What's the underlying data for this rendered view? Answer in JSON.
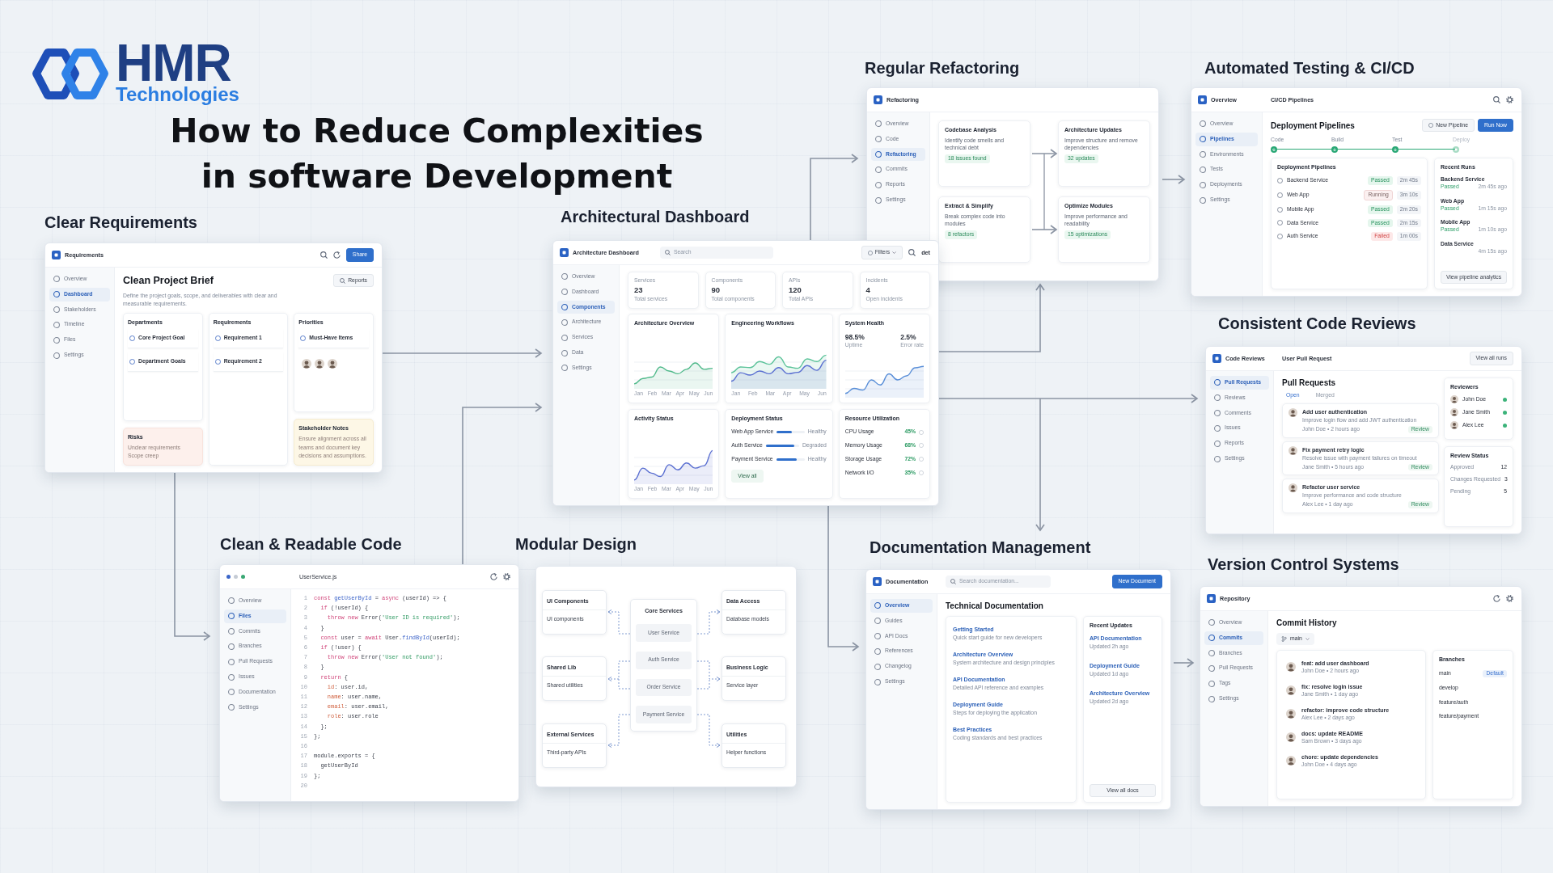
{
  "logo": {
    "brand": "HMR",
    "tagline": "Technologies"
  },
  "title": [
    "How to Reduce Complexities",
    "in software Development"
  ],
  "sections": [
    {
      "kind": "requirements",
      "heading": "Clear Requirements",
      "app": "Requirements",
      "share": "Share",
      "nav": [
        {
          "label": "Overview",
          "selected": false
        },
        {
          "label": "Dashboard",
          "selected": true
        },
        {
          "label": "Stakeholders",
          "selected": false
        },
        {
          "label": "Timeline",
          "selected": false
        },
        {
          "label": "Files",
          "selected": false
        },
        {
          "label": "Settings",
          "selected": false
        }
      ],
      "title": "Clean Project Brief",
      "reports": "Reports",
      "description": "Define the project goals, scope, and deliverables with clear and measurable requirements.",
      "columns": [
        {
          "title": "Departments",
          "items": [
            "Core Project Goal",
            "Department Goals"
          ],
          "note": {
            "kind": "risk",
            "title": "Risks",
            "items": [
              "Unclear requirements",
              "Scope creep"
            ]
          }
        },
        {
          "title": "Requirements",
          "items": [
            "Requirement 1",
            "Requirement 2"
          ]
        },
        {
          "title": "Priorities",
          "items": [
            "Must-Have Items"
          ],
          "avatars": [
            {
              "kind": "photo"
            },
            {
              "kind": "photo"
            },
            {
              "kind": "photo"
            }
          ],
          "note": {
            "kind": "info",
            "title": "Stakeholder Notes",
            "text": "Ensure alignment across all teams and document key decisions and assumptions."
          }
        }
      ]
    },
    {
      "kind": "dashboard",
      "heading": "Architectural Dashboard",
      "app": "Architecture Dashboard",
      "search": {
        "placeholder": "Search"
      },
      "filters": "Filters",
      "user": "det",
      "nav": [
        {
          "label": "Overview",
          "selected": false
        },
        {
          "label": "Dashboard",
          "selected": false
        },
        {
          "label": "Components",
          "selected": true
        },
        {
          "label": "Architecture",
          "selected": false
        },
        {
          "label": "Services",
          "selected": false
        },
        {
          "label": "Data",
          "selected": false
        },
        {
          "label": "Settings",
          "selected": false
        }
      ],
      "stats": [
        {
          "label": "Services",
          "value": "23",
          "caption": "Total services"
        },
        {
          "label": "Components",
          "value": "90",
          "caption": "Total components"
        },
        {
          "label": "APIs",
          "value": "120",
          "caption": "Total APIs"
        },
        {
          "label": "Incidents",
          "value": "4",
          "caption": "Open incidents"
        }
      ],
      "cards": [
        {
          "kind": "line",
          "title": "Architecture Overview",
          "months": [
            "Jan",
            "Feb",
            "Mar",
            "Apr",
            "May",
            "Jun"
          ]
        },
        {
          "kind": "dual",
          "title": "Engineering Workflows",
          "months": [
            "Jan",
            "Feb",
            "Mar",
            "Apr",
            "May",
            "Jun"
          ]
        },
        {
          "kind": "health",
          "title": "System Health",
          "metrics": [
            {
              "value": "98.5%",
              "label": "Uptime"
            },
            {
              "value": "2.5%",
              "label": "Error rate"
            }
          ]
        },
        {
          "kind": "line",
          "title": "Activity Status",
          "months": [
            "Jan",
            "Feb",
            "Mar",
            "Apr",
            "May",
            "Jun"
          ]
        },
        {
          "kind": "deploy",
          "title": "Deployment Status",
          "rows": [
            {
              "name": "Web App Service",
              "level": 0.55,
              "status": "Healthy"
            },
            {
              "name": "Auth Service",
              "level": 0.85,
              "status": "Degraded"
            },
            {
              "name": "Payment Service",
              "level": 0.72,
              "status": "Healthy"
            }
          ],
          "button": "View all"
        },
        {
          "kind": "resources",
          "title": "Resource Utilization",
          "rows": [
            {
              "name": "CPU Usage",
              "value": "45%"
            },
            {
              "name": "Memory Usage",
              "value": "68%"
            },
            {
              "name": "Storage Usage",
              "value": "72%"
            },
            {
              "name": "Network I/O",
              "value": "35%"
            }
          ]
        }
      ]
    },
    {
      "kind": "refactoring",
      "heading": "Regular Refactoring",
      "app": "Refactoring",
      "nav": [
        {
          "label": "Overview",
          "selected": false
        },
        {
          "label": "Code",
          "selected": false
        },
        {
          "label": "Refactoring",
          "selected": true
        },
        {
          "label": "Commits",
          "selected": false
        },
        {
          "label": "Reports",
          "selected": false
        },
        {
          "label": "Settings",
          "selected": false
        }
      ],
      "steps": [
        {
          "title": "Codebase Analysis",
          "text": "Identify code smells and technical debt",
          "badge": "18 issues found"
        },
        {
          "title": "Architecture Updates",
          "text": "Improve structure and remove dependencies",
          "badge": "32 updates"
        },
        {
          "title": "Extract & Simplify",
          "text": "Break complex code into modules",
          "badge": "8 refactors"
        },
        {
          "title": "Optimize Modules",
          "text": "Improve performance and readability",
          "badge": "15 optimizations"
        }
      ]
    },
    {
      "kind": "pipelines",
      "heading": "Automated Testing & CI/CD",
      "app": "Overview",
      "page": "CI/CD Pipelines",
      "nav": [
        {
          "label": "Overview",
          "selected": false
        },
        {
          "label": "Pipelines",
          "selected": true
        },
        {
          "label": "Environments",
          "selected": false
        },
        {
          "label": "Tests",
          "selected": false
        },
        {
          "label": "Deployments",
          "selected": false
        },
        {
          "label": "Settings",
          "selected": false
        }
      ],
      "title": "Deployment Pipelines",
      "buttons": [
        {
          "label": "New Pipeline",
          "kind": "outline"
        },
        {
          "label": "Run Now",
          "kind": "primary"
        }
      ],
      "stages": [
        {
          "label": "Code",
          "done": true
        },
        {
          "label": "Build",
          "done": true
        },
        {
          "label": "Test",
          "done": true
        },
        {
          "label": "Deploy",
          "done": false
        }
      ],
      "list": {
        "title": "Deployment Pipelines",
        "rows": [
          {
            "name": "Backend Service",
            "status": "Passed",
            "kind": "passed",
            "time": "2m 45s"
          },
          {
            "name": "Web App",
            "status": "Running",
            "kind": "running",
            "time": "3m 10s"
          },
          {
            "name": "Mobile App",
            "status": "Passed",
            "kind": "passed",
            "time": "2m 20s"
          },
          {
            "name": "Data Service",
            "status": "Passed",
            "kind": "passed",
            "time": "2m 15s"
          },
          {
            "name": "Auth Service",
            "status": "Failed",
            "kind": "failed",
            "time": "1m 00s"
          }
        ]
      },
      "recent": {
        "title": "Recent Runs",
        "runs": [
          {
            "name": "Backend Service",
            "status": "Passed",
            "time": "2m 45s ago"
          },
          {
            "name": "Web App",
            "status": "Passed",
            "time": "1m 15s ago"
          },
          {
            "name": "Mobile App",
            "status": "Passed",
            "time": "1m 10s ago"
          },
          {
            "name": "Data Service",
            "time": "4m 15s ago"
          }
        ],
        "button": "View pipeline analytics"
      }
    },
    {
      "kind": "reviews",
      "heading": "Consistent Code Reviews",
      "app": "Code Reviews",
      "page": "User Pull Request",
      "action": "View all runs",
      "nav": [
        {
          "label": "Pull Requests",
          "selected": true
        },
        {
          "label": "Reviews",
          "selected": false
        },
        {
          "label": "Comments",
          "selected": false
        },
        {
          "label": "Issues",
          "selected": false
        },
        {
          "label": "Reports",
          "selected": false
        },
        {
          "label": "Settings",
          "selected": false
        }
      ],
      "title": "Pull Requests",
      "tabs": [
        {
          "label": "Open",
          "selected": true
        },
        {
          "label": "Merged",
          "selected": false
        }
      ],
      "prs": [
        {
          "title": "Add user authentication",
          "text": "Improve login flow and add JWT authentication",
          "meta": "John Doe • 2 hours ago",
          "badge": "Review"
        },
        {
          "title": "Fix payment retry logic",
          "text": "Resolve issue with payment failures on timeout",
          "meta": "Jane Smith • 5 hours ago",
          "badge": "Review"
        },
        {
          "title": "Refactor user service",
          "text": "Improve performance and code structure",
          "meta": "Alex Lee • 1 day ago",
          "badge": "Review"
        }
      ],
      "reviewers": {
        "title": "Reviewers",
        "people": [
          {
            "name": "John Doe",
            "online": true
          },
          {
            "name": "Jane Smith",
            "online": true
          },
          {
            "name": "Alex Lee",
            "online": true
          }
        ]
      },
      "status": {
        "title": "Review Status",
        "rows": [
          {
            "label": "Approved",
            "value": "12"
          },
          {
            "label": "Changes Requested",
            "value": "3"
          },
          {
            "label": "Pending",
            "value": "5"
          }
        ]
      }
    },
    {
      "kind": "code",
      "heading": "Clean & Readable Code",
      "file": "UserService.js",
      "dots": [
        {
          "color": "#3b66c9"
        },
        {
          "color": "#c5cbd4"
        },
        {
          "color": "#3aa874"
        }
      ],
      "nav": [
        {
          "label": "Overview",
          "selected": false
        },
        {
          "label": "Files",
          "selected": true
        },
        {
          "label": "Commits",
          "selected": false
        },
        {
          "label": "Branches",
          "selected": false
        },
        {
          "label": "Pull Requests",
          "selected": false
        },
        {
          "label": "Issues",
          "selected": false
        },
        {
          "label": "Documentation",
          "selected": false
        },
        {
          "label": "Settings",
          "selected": false
        }
      ],
      "lines": [
        {
          "number": "1",
          "tokens": [
            {
              "kind": "kw",
              "text": "const "
            },
            {
              "kind": "fn",
              "text": "getUserById"
            },
            {
              "kind": "txt",
              "text": " = "
            },
            {
              "kind": "kw",
              "text": "async"
            },
            {
              "kind": "txt",
              "text": " (userId) => {"
            }
          ]
        },
        {
          "number": "2",
          "tokens": [
            {
              "kind": "kw",
              "text": "  if"
            },
            {
              "kind": "txt",
              "text": " (!userId) {"
            }
          ]
        },
        {
          "number": "3",
          "tokens": [
            {
              "kind": "kw",
              "text": "    throw new"
            },
            {
              "kind": "txt",
              "text": " Error("
            },
            {
              "kind": "str",
              "text": "'User ID is required'"
            },
            {
              "kind": "txt",
              "text": ");"
            }
          ]
        },
        {
          "number": "4",
          "tokens": [
            {
              "kind": "txt",
              "text": "  }"
            }
          ]
        },
        {
          "number": "5",
          "tokens": [
            {
              "kind": "kw",
              "text": "  const"
            },
            {
              "kind": "txt",
              "text": " user = "
            },
            {
              "kind": "kw",
              "text": "await"
            },
            {
              "kind": "txt",
              "text": " User."
            },
            {
              "kind": "fn",
              "text": "findById"
            },
            {
              "kind": "txt",
              "text": "(userId);"
            }
          ]
        },
        {
          "number": "6",
          "tokens": [
            {
              "kind": "kw",
              "text": "  if"
            },
            {
              "kind": "txt",
              "text": " (!user) {"
            }
          ]
        },
        {
          "number": "7",
          "tokens": [
            {
              "kind": "kw",
              "text": "    throw new"
            },
            {
              "kind": "txt",
              "text": " Error("
            },
            {
              "kind": "str",
              "text": "'User not found'"
            },
            {
              "kind": "txt",
              "text": ");"
            }
          ]
        },
        {
          "number": "8",
          "tokens": [
            {
              "kind": "txt",
              "text": "  }"
            }
          ]
        },
        {
          "number": "9",
          "tokens": [
            {
              "kind": "kw",
              "text": "  return"
            },
            {
              "kind": "txt",
              "text": " {"
            }
          ]
        },
        {
          "number": "10",
          "tokens": [
            {
              "kind": "prop",
              "text": "    id"
            },
            {
              "kind": "txt",
              "text": ": user.id,"
            }
          ]
        },
        {
          "number": "11",
          "tokens": [
            {
              "kind": "prop",
              "text": "    name"
            },
            {
              "kind": "txt",
              "text": ": user.name,"
            }
          ]
        },
        {
          "number": "12",
          "tokens": [
            {
              "kind": "prop",
              "text": "    email"
            },
            {
              "kind": "txt",
              "text": ": user.email,"
            }
          ]
        },
        {
          "number": "13",
          "tokens": [
            {
              "kind": "prop",
              "text": "    role"
            },
            {
              "kind": "txt",
              "text": ": user.role"
            }
          ]
        },
        {
          "number": "14",
          "tokens": [
            {
              "kind": "txt",
              "text": "  };"
            }
          ]
        },
        {
          "number": "15",
          "tokens": [
            {
              "kind": "txt",
              "text": "};"
            }
          ]
        },
        {
          "number": "16"
        },
        {
          "number": "17",
          "tokens": [
            {
              "kind": "txt",
              "text": "module.exports = {"
            }
          ]
        },
        {
          "number": "18",
          "tokens": [
            {
              "kind": "txt",
              "text": "  getUserById"
            }
          ]
        },
        {
          "number": "19",
          "tokens": [
            {
              "kind": "txt",
              "text": "};"
            }
          ]
        },
        {
          "number": "20"
        }
      ]
    },
    {
      "kind": "modular",
      "heading": "Modular Design",
      "left": [
        {
          "title": "UI Components",
          "text": "UI components"
        },
        {
          "title": "Shared Lib",
          "text": "Shared utilities"
        },
        {
          "title": "External Services",
          "text": "Third-party APIs"
        }
      ],
      "core": {
        "title": "Core Services",
        "items": [
          "User Service",
          "Auth Service",
          "Order Service",
          "Payment Service"
        ]
      },
      "right": [
        {
          "title": "Data Access",
          "text": "Database models"
        },
        {
          "title": "Business Logic",
          "text": "Service layer"
        },
        {
          "title": "Utilities",
          "text": "Helper functions"
        }
      ]
    },
    {
      "kind": "docs",
      "heading": "Documentation Management",
      "app": "Documentation",
      "search": {
        "placeholder": "Search documentation..."
      },
      "action": "New Document",
      "nav": [
        {
          "label": "Overview",
          "selected": true
        },
        {
          "label": "Guides",
          "selected": false
        },
        {
          "label": "API Docs",
          "selected": false
        },
        {
          "label": "References",
          "selected": false
        },
        {
          "label": "Changelog",
          "selected": false
        },
        {
          "label": "Settings",
          "selected": false
        }
      ],
      "title": "Technical Documentation",
      "docs": [
        {
          "title": "Getting Started",
          "text": "Quick start guide for new developers"
        },
        {
          "title": "Architecture Overview",
          "text": "System architecture and design principles"
        },
        {
          "title": "API Documentation",
          "text": "Detailed API reference and examples"
        },
        {
          "title": "Deployment Guide",
          "text": "Steps for deploying the application"
        },
        {
          "title": "Best Practices",
          "text": "Coding standards and best practices"
        }
      ],
      "recent": {
        "title": "Recent Updates",
        "items": [
          {
            "title": "API Documentation",
            "meta": "Updated 2h ago"
          },
          {
            "title": "Deployment Guide",
            "meta": "Updated 1d ago"
          },
          {
            "title": "Architecture Overview",
            "meta": "Updated 2d ago"
          }
        ],
        "button": "View all docs"
      }
    },
    {
      "kind": "repository",
      "heading": "Version Control Systems",
      "app": "Repository",
      "nav": [
        {
          "label": "Overview",
          "selected": false
        },
        {
          "label": "Commits",
          "selected": true
        },
        {
          "label": "Branches",
          "selected": false
        },
        {
          "label": "Pull Requests",
          "selected": false
        },
        {
          "label": "Tags",
          "selected": false
        },
        {
          "label": "Settings",
          "selected": false
        }
      ],
      "title": "Commit History",
      "branch": "main",
      "commits": [
        {
          "message": "feat: add user dashboard",
          "meta": "John Doe • 2 hours ago"
        },
        {
          "message": "fix: resolve login issue",
          "meta": "Jane Smith • 1 day ago"
        },
        {
          "message": "refactor: improve code structure",
          "meta": "Alex Lee • 2 days ago"
        },
        {
          "message": "docs: update README",
          "meta": "Sam Brown • 3 days ago"
        },
        {
          "message": "chore: update dependencies",
          "meta": "John Doe • 4 days ago"
        }
      ],
      "branches": {
        "title": "Branches",
        "items": [
          {
            "name": "main",
            "badge": "Default"
          },
          {
            "name": "develop"
          },
          {
            "name": "feature/auth"
          },
          {
            "name": "feature/payment"
          }
        ]
      }
    }
  ]
}
